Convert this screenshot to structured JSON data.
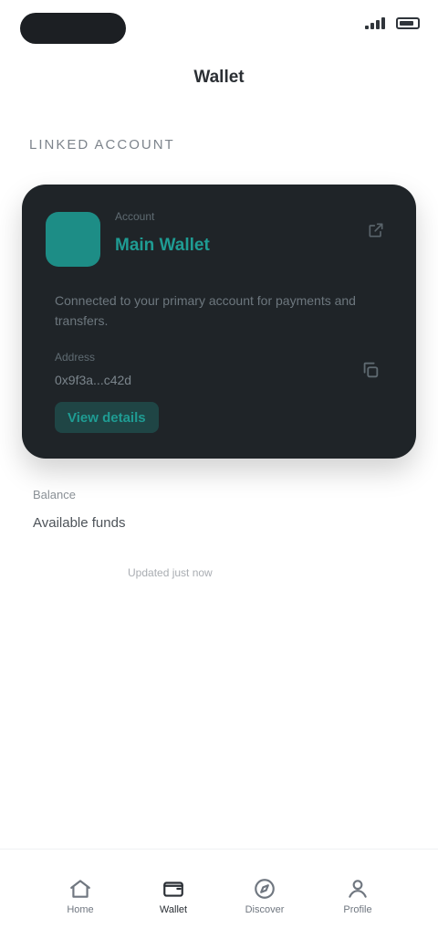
{
  "status_bar": {
    "signal_icon": "signal-icon",
    "battery_icon": "battery-icon"
  },
  "header": {
    "title": "Wallet"
  },
  "section": {
    "label": "Linked Account"
  },
  "card": {
    "eyebrow": "Account",
    "title": "Main Wallet",
    "description": "Connected to your primary account for payments and transfers.",
    "meta_label": "Address",
    "meta_value": "0x9f3a...c42d",
    "action_label": "View details",
    "accent_color": "#1f9c93",
    "background_color": "#1f2428",
    "corner_icon": "external-link-icon",
    "copy_icon": "copy-icon"
  },
  "below": {
    "label": "Balance",
    "value": "Available funds",
    "sub": "Updated just now"
  },
  "bottom_nav": {
    "items": [
      {
        "label": "Home",
        "icon": "home-icon"
      },
      {
        "label": "Wallet",
        "icon": "wallet-icon"
      },
      {
        "label": "Discover",
        "icon": "compass-icon"
      },
      {
        "label": "Profile",
        "icon": "user-icon"
      }
    ]
  }
}
